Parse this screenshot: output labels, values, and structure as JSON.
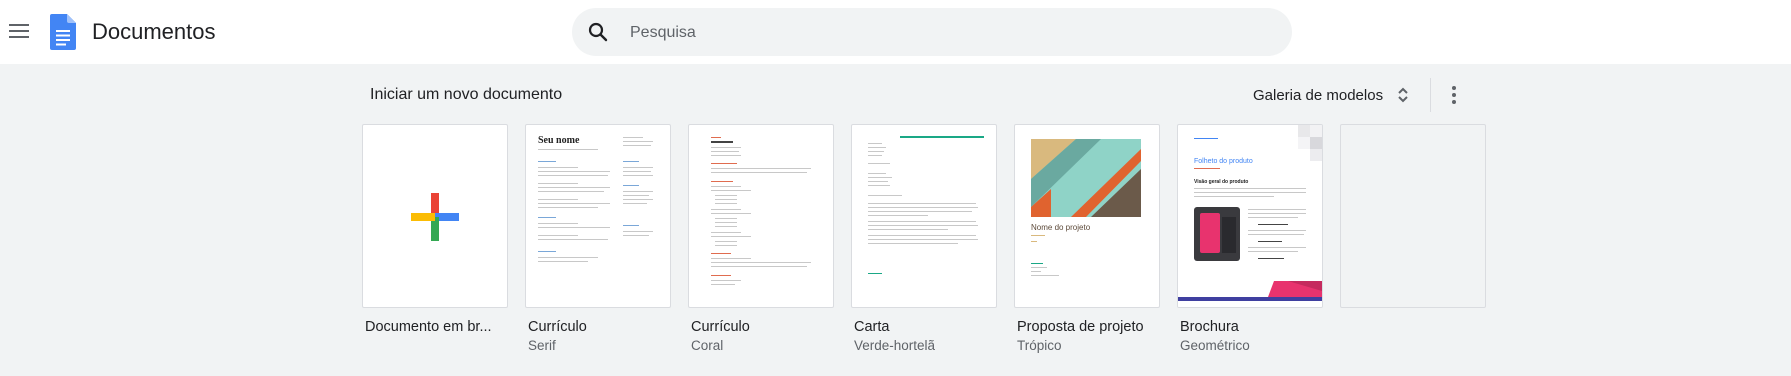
{
  "header": {
    "app_title": "Documentos",
    "search_placeholder": "Pesquisa"
  },
  "section": {
    "title": "Iniciar um novo documento",
    "gallery_label": "Galeria de modelos"
  },
  "templates": [
    {
      "name": "Documento em br...",
      "subtitle": ""
    },
    {
      "name": "Currículo",
      "subtitle": "Serif",
      "thumb_heading": "Seu nome"
    },
    {
      "name": "Currículo",
      "subtitle": "Coral"
    },
    {
      "name": "Carta",
      "subtitle": "Verde-hortelã"
    },
    {
      "name": "Proposta de projeto",
      "subtitle": "Trópico",
      "thumb_heading": "Nome do projeto"
    },
    {
      "name": "Brochura",
      "subtitle": "Geométrico",
      "thumb_heading": "Folheto do produto",
      "thumb_subheading": "Visão geral do produto"
    }
  ],
  "colors": {
    "accent_blue": "#4285f4",
    "red": "#ea4335",
    "yellow": "#fbbc04",
    "green": "#34a853",
    "coral": "#e06c4f",
    "mint": "#1aa886",
    "teal": "#8fd3c7"
  },
  "icons": [
    "menu-icon",
    "docs-logo-icon",
    "search-icon",
    "unfold-icon",
    "more-vert-icon",
    "plus-icon"
  ]
}
